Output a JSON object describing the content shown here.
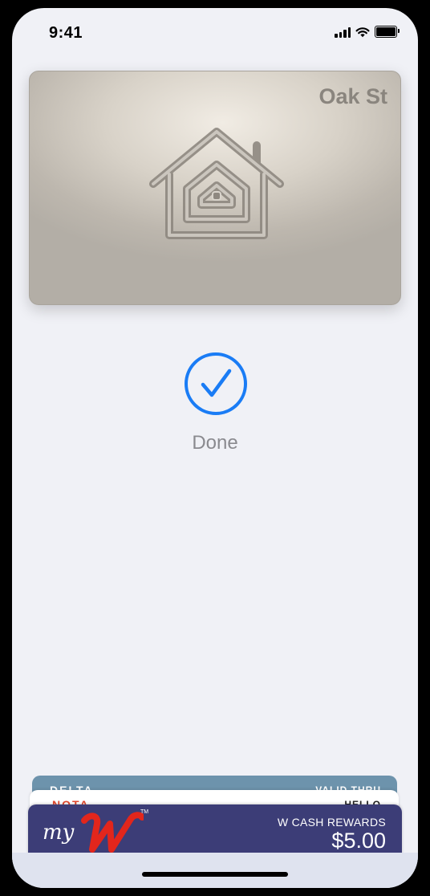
{
  "status_bar": {
    "time": "9:41"
  },
  "home_key_card": {
    "title": "Oak St"
  },
  "status": {
    "label": "Done",
    "accent_color": "#1a7cf5"
  },
  "wallet_stack": {
    "delta_card": {
      "left_label": "DELTA",
      "right_label": "VALID THRU"
    },
    "hello_card": {
      "left_label": "NOTA",
      "right_label": "HELLO"
    },
    "rewards_card": {
      "brand_prefix": "my",
      "brand_letter": "W",
      "trademark": "TM",
      "rewards_label": "W CASH REWARDS",
      "amount": "$5.00"
    }
  }
}
